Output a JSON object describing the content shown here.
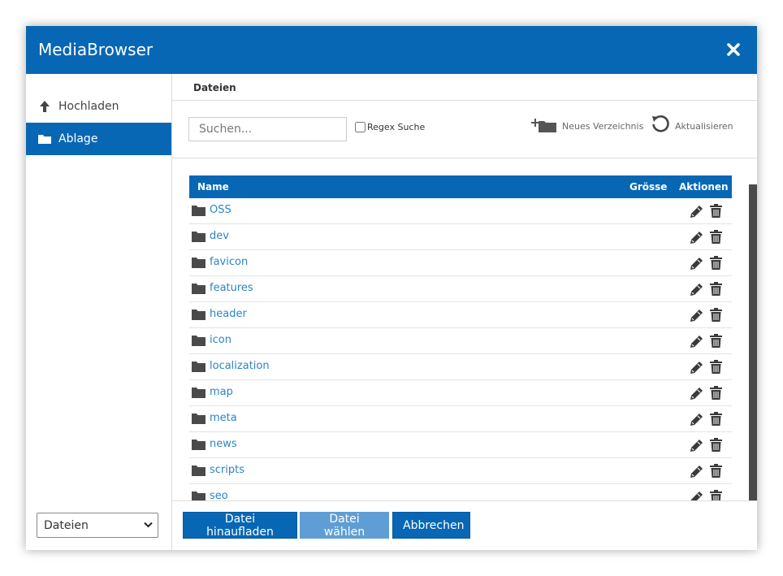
{
  "dialog": {
    "title": "MediaBrowser"
  },
  "sidebar": {
    "items": [
      {
        "label": "Hochladen",
        "icon": "arrow-up-icon"
      },
      {
        "label": "Ablage",
        "icon": "folder-icon",
        "active": true
      }
    ],
    "select": {
      "value": "Dateien"
    }
  },
  "main": {
    "header": "Dateien",
    "search": {
      "placeholder": "Suchen..."
    },
    "regex_label": "Regex Suche",
    "new_folder_label": "Neues Verzeichnis",
    "refresh_label": "Aktualisieren",
    "table": {
      "headers": {
        "name": "Name",
        "size": "Grösse",
        "actions": "Aktionen"
      },
      "rows": [
        "OSS",
        "dev",
        "favicon",
        "features",
        "header",
        "icon",
        "localization",
        "map",
        "meta",
        "news",
        "scripts",
        "seo"
      ]
    }
  },
  "footer": {
    "upload_label": "Datei hinaufladen",
    "choose_label": "Datei wählen",
    "cancel_label": "Abbrechen"
  },
  "colors": {
    "accent": "#0867b4",
    "link": "#2c84c6",
    "disabled": "#5f9ed4"
  }
}
